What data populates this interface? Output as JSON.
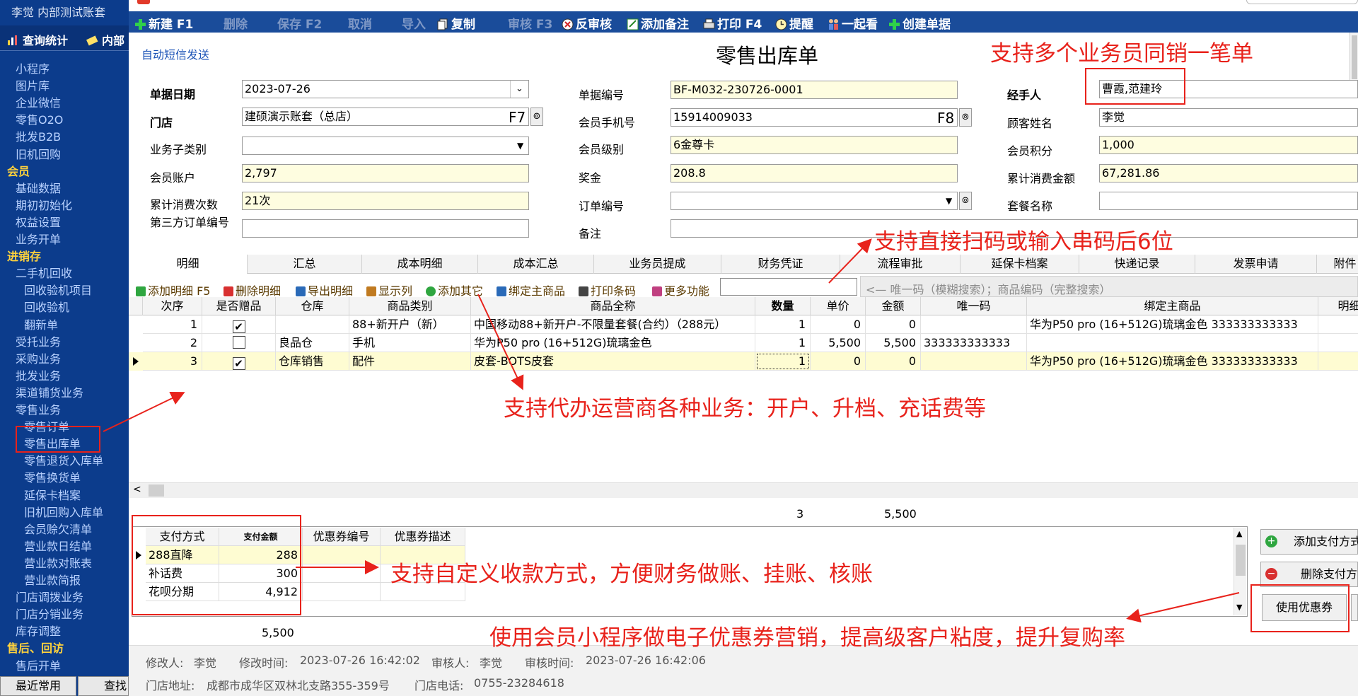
{
  "sidebar": {
    "user": "李觉  内部测试账套",
    "top_buttons": [
      "查询统计",
      "内部"
    ],
    "items": [
      {
        "label": "小程序",
        "type": "item"
      },
      {
        "label": "图片库",
        "type": "item"
      },
      {
        "label": "企业微信",
        "type": "item"
      },
      {
        "label": "零售O2O",
        "type": "item"
      },
      {
        "label": "批发B2B",
        "type": "item"
      },
      {
        "label": "旧机回购",
        "type": "item"
      },
      {
        "label": "会员",
        "type": "section"
      },
      {
        "label": "基础数据",
        "type": "item"
      },
      {
        "label": "期初初始化",
        "type": "item"
      },
      {
        "label": "权益设置",
        "type": "item"
      },
      {
        "label": "业务开单",
        "type": "item"
      },
      {
        "label": "进销存",
        "type": "section"
      },
      {
        "label": "二手机回收",
        "type": "item"
      },
      {
        "label": "回收验机项目",
        "type": "sub"
      },
      {
        "label": "回收验机",
        "type": "sub"
      },
      {
        "label": "翻新单",
        "type": "sub"
      },
      {
        "label": "受托业务",
        "type": "item"
      },
      {
        "label": "采购业务",
        "type": "item"
      },
      {
        "label": "批发业务",
        "type": "item"
      },
      {
        "label": "渠道铺货业务",
        "type": "item"
      },
      {
        "label": "零售业务",
        "type": "item"
      },
      {
        "label": "零售订单",
        "type": "sub"
      },
      {
        "label": "零售出库单",
        "type": "sub"
      },
      {
        "label": "零售退货入库单",
        "type": "sub"
      },
      {
        "label": "零售换货单",
        "type": "sub"
      },
      {
        "label": "延保卡档案",
        "type": "sub"
      },
      {
        "label": "旧机回购入库单",
        "type": "sub"
      },
      {
        "label": "会员赊欠清单",
        "type": "sub"
      },
      {
        "label": "营业款日结单",
        "type": "sub"
      },
      {
        "label": "营业款对账表",
        "type": "sub"
      },
      {
        "label": "营业款简报",
        "type": "sub"
      },
      {
        "label": "门店调拨业务",
        "type": "item"
      },
      {
        "label": "门店分销业务",
        "type": "item"
      },
      {
        "label": "库存调整",
        "type": "item"
      },
      {
        "label": "售后、回访",
        "type": "section"
      },
      {
        "label": "售后开单",
        "type": "item"
      }
    ],
    "bottom_tabs": [
      "最近常用",
      "查找"
    ]
  },
  "toolbar": [
    {
      "label": "新建 F1",
      "icon": "plus-icon",
      "enabled": true
    },
    {
      "label": "删除",
      "icon": "",
      "enabled": false
    },
    {
      "label": "保存 F2",
      "icon": "",
      "enabled": false
    },
    {
      "label": "取消",
      "icon": "",
      "enabled": false
    },
    {
      "label": "导入",
      "icon": "",
      "enabled": false
    },
    {
      "label": "复制",
      "icon": "copy-icon",
      "enabled": true
    },
    {
      "label": "审核 F3",
      "icon": "",
      "enabled": false
    },
    {
      "label": "反审核",
      "icon": "unapprove-icon",
      "enabled": true
    },
    {
      "label": "添加备注",
      "icon": "note-icon",
      "enabled": true
    },
    {
      "label": "打印 F4",
      "icon": "printer-icon",
      "enabled": true
    },
    {
      "label": "提醒",
      "icon": "clock-icon",
      "enabled": true
    },
    {
      "label": "一起看",
      "icon": "people-icon",
      "enabled": true
    },
    {
      "label": "创建单据",
      "icon": "plus-icon",
      "enabled": true
    }
  ],
  "form": {
    "sms_link": "自动短信发送",
    "title": "零售出库单",
    "fields": {
      "doc_date": {
        "label": "单据日期",
        "value": "2023-07-26"
      },
      "store": {
        "label": "门店",
        "value": "建硕演示账套（总店）",
        "key": "F7"
      },
      "subtype": {
        "label": "业务子类别",
        "value": ""
      },
      "member_account": {
        "label": "会员账户",
        "value": "2,797"
      },
      "consume_count": {
        "label": "累计消费次数",
        "value": "21次"
      },
      "third_order": {
        "label": "第三方订单编号",
        "value": ""
      },
      "doc_no": {
        "label": "单据编号",
        "value": "BF-M032-230726-0001"
      },
      "member_phone": {
        "label": "会员手机号",
        "value": "15914009033",
        "key": "F8"
      },
      "member_level": {
        "label": "会员级别",
        "value": "6金尊卡"
      },
      "bonus": {
        "label": "奖金",
        "value": "208.8"
      },
      "order_no": {
        "label": "订单编号",
        "value": ""
      },
      "remark": {
        "label": "备注",
        "value": ""
      },
      "handler": {
        "label": "经手人",
        "value": "曹霞,范建玲"
      },
      "customer": {
        "label": "顾客姓名",
        "value": "李觉"
      },
      "points": {
        "label": "会员积分",
        "value": "1,000"
      },
      "total_amount": {
        "label": "累计消费金额",
        "value": "67,281.86"
      },
      "package": {
        "label": "套餐名称",
        "value": ""
      }
    }
  },
  "annotations": {
    "multi_sales": "支持多个业务员同销一笔单",
    "scan": "支持直接扫码或输入串码后6位",
    "agent": "支持代办运营商各种业务：开户、升档、充话费等",
    "payment": "支持自定义收款方式，方便财务做账、挂账、核账",
    "coupon": "使用会员小程序做电子优惠券营销，提高级客户粘度，提升复购率"
  },
  "tabs": [
    "明细",
    "汇总",
    "成本明细",
    "成本汇总",
    "业务员提成",
    "财务凭证",
    "流程审批",
    "延保卡档案",
    "快递记录",
    "发票申请",
    "附件"
  ],
  "subtoolbar": {
    "buttons": [
      {
        "label": "添加明细 F5",
        "icon": "plus-icon"
      },
      {
        "label": "删除明细",
        "icon": "delete-icon"
      },
      {
        "label": "导出明细",
        "icon": "export-icon"
      },
      {
        "label": "显示列",
        "icon": "columns-icon"
      },
      {
        "label": "添加其它",
        "icon": "add-other-icon"
      },
      {
        "label": "绑定主商品",
        "icon": "bind-icon"
      },
      {
        "label": "打印条码",
        "icon": "barcode-icon"
      },
      {
        "label": "更多功能",
        "icon": "more-icon"
      }
    ],
    "search_hint": "<— 唯一码（模糊搜索）；商品编码（完整搜索）"
  },
  "grid": {
    "columns": [
      "次序",
      "是否赠品",
      "仓库",
      "商品类别",
      "商品全称",
      "数量",
      "单价",
      "金额",
      "唯一码",
      "绑定主商品",
      "明细摘要"
    ],
    "rows": [
      {
        "seq": "1",
        "gift": true,
        "warehouse": "",
        "category": "88+新开户（新）",
        "name": "中国移动88+新开户-不限量套餐(合约）（288元）",
        "qty": "1",
        "price": "0",
        "amount": "0",
        "uid": "",
        "bind": "华为P50 pro (16+512G)琉璃金色 333333333333",
        "memo": ""
      },
      {
        "seq": "2",
        "gift": false,
        "warehouse": "良品仓",
        "category": "手机",
        "name": "华为P50 pro (16+512G)琉璃金色",
        "qty": "1",
        "price": "5,500",
        "amount": "5,500",
        "uid": "333333333333",
        "bind": "",
        "memo": ""
      },
      {
        "seq": "3",
        "gift": true,
        "warehouse": "仓库销售",
        "category": "配件",
        "name": "皮套-BOTS皮套",
        "qty": "1",
        "price": "0",
        "amount": "0",
        "uid": "",
        "bind": "华为P50 pro (16+512G)琉璃金色 333333333333",
        "memo": ""
      }
    ],
    "totals": {
      "qty": "3",
      "amount": "5,500"
    }
  },
  "payment": {
    "columns": [
      "支付方式",
      "支付金额",
      "优惠券编号",
      "优惠券描述"
    ],
    "rows": [
      {
        "method": "288直降",
        "amount": "288"
      },
      {
        "method": "补话费",
        "amount": "300"
      },
      {
        "method": "花呗分期",
        "amount": "4,912"
      }
    ],
    "total": "5,500",
    "buttons": [
      "添加支付方式",
      "删除支付方式",
      "使用优惠券"
    ]
  },
  "footer": {
    "modifier_label": "修改人:",
    "modifier": "李觉",
    "modify_time_label": "修改时间:",
    "modify_time": "2023-07-26 16:42:02",
    "auditor_label": "审核人:",
    "auditor": "李觉",
    "audit_time_label": "审核时间:",
    "audit_time": "2023-07-26 16:42:06",
    "address_label": "门店地址:",
    "address": "成都市成华区双林北支路355-359号",
    "phone_label": "门店电话:",
    "phone": "0755-23284618"
  },
  "colors": {
    "sidebar": "#0c3c8c",
    "toolbar": "#1a4c9a",
    "section": "#ffd23c",
    "annotation": "#e8221b",
    "yellow_field": "#fefde0"
  }
}
